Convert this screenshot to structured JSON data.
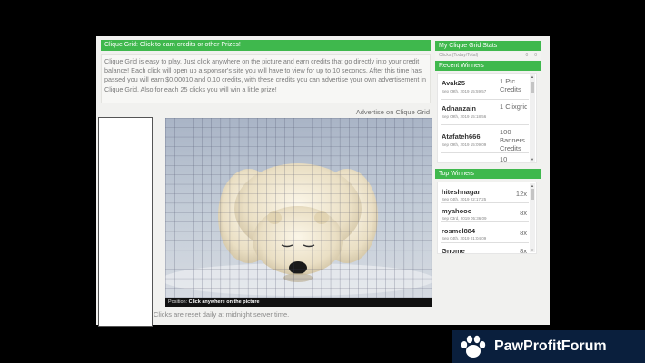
{
  "header": {
    "title": "Clique Grid: Click to earn credits or other Prizes!"
  },
  "intro": {
    "text": "Clique Grid is easy to play. Just click anywhere on the picture and earn credits that go directly into your credit balance! Each click will open up a sponsor's site you will have to view for up to 10 seconds. After this time has passed you will earn $0.00010 and 0.10 credits, with these credits you can advertise your own advertisement in Clique Grid. Also for each 25 clicks you will win a little prize!"
  },
  "advertise_link": "Advertise on Clique Grid",
  "grid": {
    "position_label": "Position:",
    "position_value": "Click anywhere on the picture"
  },
  "reset_note": "Clicks are reset daily at midnight server time.",
  "stats": {
    "title": "My Clique Grid Stats",
    "clicks_label": "Clicks (Today/Total)",
    "today": "0",
    "total": "0"
  },
  "recent_winners": {
    "title": "Recent Winners",
    "items": [
      {
        "name": "Avak25",
        "date": "Sep 09th, 2019 15:59:57",
        "prize": "1 Ptc Credits"
      },
      {
        "name": "Adnanzain",
        "date": "Sep 09th, 2019 15:18:56",
        "prize": "1 Clixgrid Credits"
      },
      {
        "name": "Atafateh666",
        "date": "Sep 09th, 2019 15:09:09",
        "prize": "100 Banners Credits"
      },
      {
        "name": "",
        "date": "",
        "prize": "10"
      }
    ]
  },
  "top_winners": {
    "title": "Top Winners",
    "items": [
      {
        "name": "hiteshnagar",
        "date": "Sep 04th, 2019 22:17:25",
        "prize": "12x"
      },
      {
        "name": "myahooo",
        "date": "Sep 03rd, 2019 05:36:09",
        "prize": "8x"
      },
      {
        "name": "rosmel884",
        "date": "Sep 04th, 2019 01:04:09",
        "prize": "8x"
      },
      {
        "name": "Gnome",
        "date": "",
        "prize": "8x"
      }
    ]
  },
  "watermark": {
    "text": "PawProfitForum"
  },
  "colors": {
    "accent_green": "#3fb84d",
    "logo_background": "#0a1f3d"
  }
}
